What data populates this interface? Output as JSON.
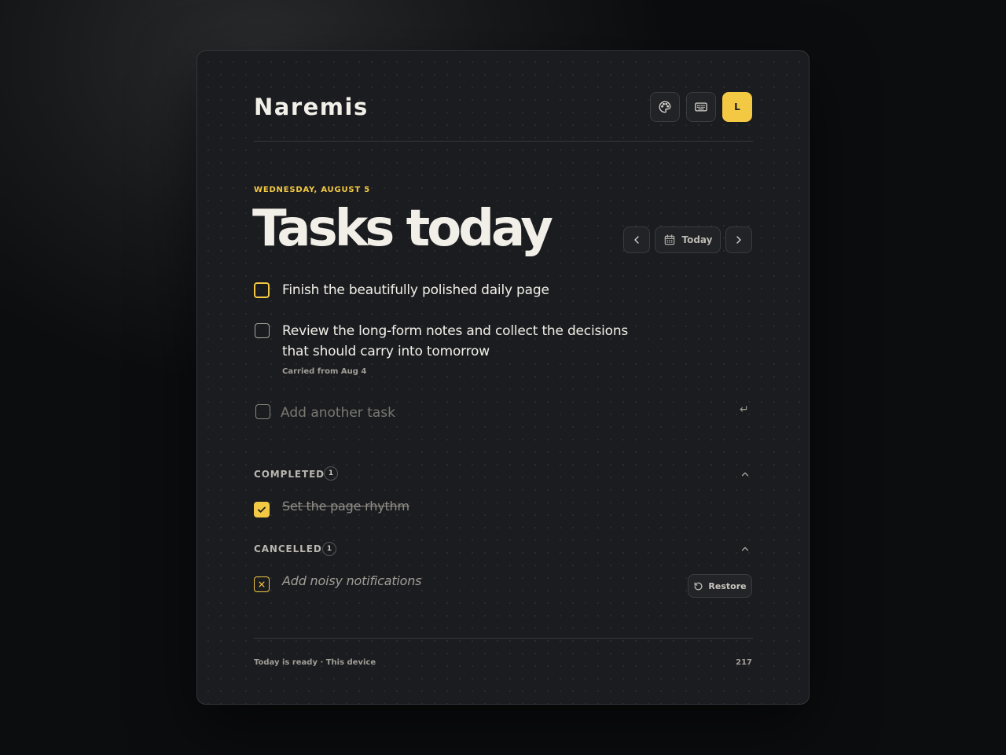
{
  "app": {
    "name": "Naremis"
  },
  "header": {
    "buttons": [
      {
        "icon": "palette-icon"
      },
      {
        "icon": "keyboard-icon"
      }
    ],
    "avatar_initial": "L"
  },
  "page": {
    "date": "WEDNESDAY, AUGUST 5",
    "title": "Tasks today",
    "nav": {
      "today_label": "Today"
    }
  },
  "tasks": [
    {
      "text": "Finish the beautifully polished daily page",
      "focused": true
    },
    {
      "text": "Review the long-form notes and collect the decisions that should carry into tomorrow",
      "meta": "Carried from Aug 4"
    }
  ],
  "add_task": {
    "placeholder": "Add another task",
    "enter_hint": "↵"
  },
  "completed": {
    "label": "COMPLETED",
    "count": "1",
    "items": [
      {
        "text": "Set the page rhythm"
      }
    ]
  },
  "cancelled": {
    "label": "CANCELLED",
    "count": "1",
    "items": [
      {
        "text": "Add noisy notifications",
        "action": "Restore"
      }
    ]
  },
  "footer": {
    "status": "Today is ready · This device",
    "count": "217"
  },
  "colors": {
    "accent": "#f3c843",
    "card_bg": "#1b1c1f",
    "text": "#f2efe8",
    "muted": "#a19e97"
  }
}
